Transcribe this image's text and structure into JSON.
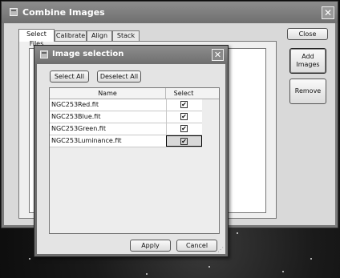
{
  "main_window": {
    "title": "Combine Images",
    "close_glyph": "✕",
    "tabs": [
      {
        "label": "Select Files",
        "active": true
      },
      {
        "label": "Calibrate",
        "active": false
      },
      {
        "label": "Align",
        "active": false
      },
      {
        "label": "Stack",
        "active": false
      }
    ],
    "close_button": "Close",
    "add_images_button": "Add\nImages",
    "remove_button": "Remove"
  },
  "dialog": {
    "title": "Image selection",
    "close_glyph": "✕",
    "select_all": "Select All",
    "deselect_all": "Deselect All",
    "columns": [
      "Name",
      "Select"
    ],
    "rows": [
      {
        "name": "NGC253Red.fit",
        "checked": true,
        "selected": false
      },
      {
        "name": "NGC253Blue.fit",
        "checked": true,
        "selected": false
      },
      {
        "name": "NGC253Green.fit",
        "checked": true,
        "selected": false
      },
      {
        "name": "NGC253Luminance.fit",
        "checked": true,
        "selected": true
      }
    ],
    "check_glyph": "✔",
    "apply_button": "Apply",
    "cancel_button": "Cancel",
    "resize_grip": "⋰"
  },
  "icons": {
    "window_icon": "window-icon",
    "close": "close-icon",
    "checkbox": "checkbox-icon"
  }
}
